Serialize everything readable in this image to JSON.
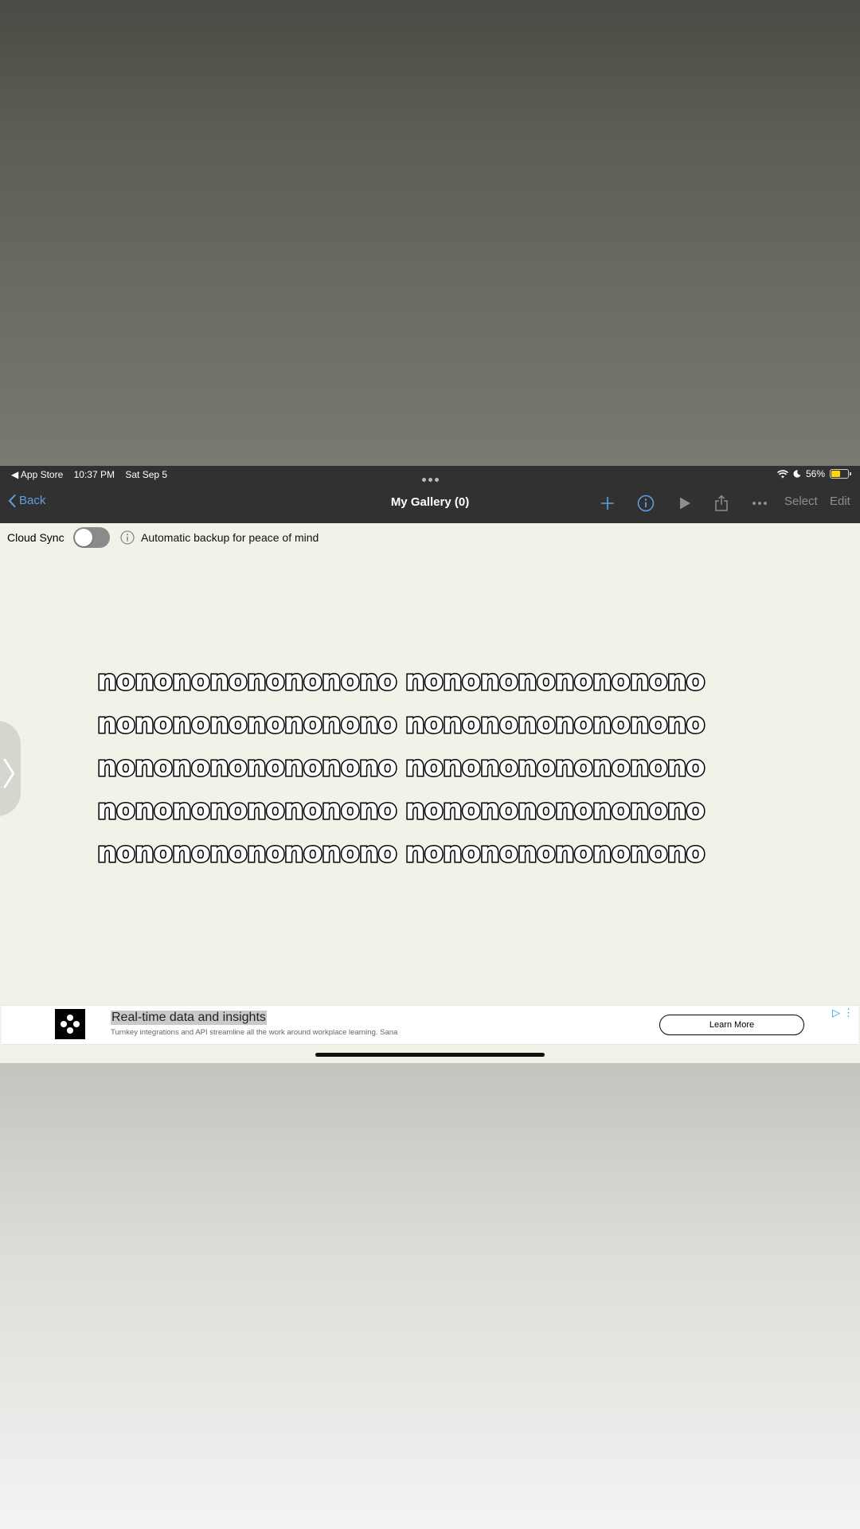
{
  "status_bar": {
    "back_app": "◀ App Store",
    "time": "10:37 PM",
    "date": "Sat Sep 5",
    "battery": "56%",
    "battery_level": 0.56
  },
  "nav": {
    "back_label": "Back",
    "title": "My Gallery (0)",
    "select_label": "Select",
    "edit_label": "Edit",
    "icons": [
      "plus-icon",
      "info-icon",
      "play-icon",
      "share-icon",
      "more-icon"
    ]
  },
  "cloud_sync": {
    "label": "Cloud Sync",
    "enabled": false,
    "description": "Automatic backup for peace of mind"
  },
  "content": {
    "lines": [
      "nononononononono nononononononono",
      "nononononononono nononononononono",
      "nononononononono nononononononono",
      "nononononononono nononononononono",
      "nononononononono nononononononono"
    ]
  },
  "ad": {
    "title": "Real-time data and insights",
    "description": "Turnkey integrations and API streamline all the work around workplace learning. Sana",
    "cta": "Learn More"
  },
  "colors": {
    "accent": "#5f9fe4",
    "toolbar": "#313131",
    "canvas": "#f2f2e8"
  }
}
